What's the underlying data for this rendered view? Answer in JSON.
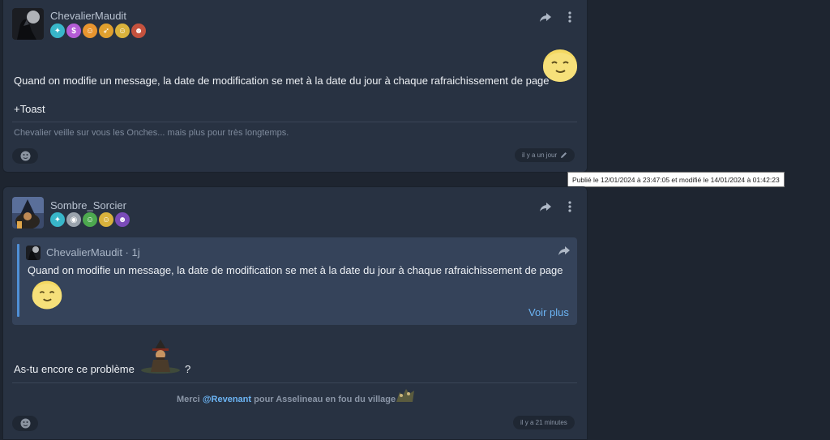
{
  "post1": {
    "username": "ChevalierMaudit",
    "badges": [
      {
        "name": "diamond-badge",
        "color": "#38b6c9",
        "glyph": "✦"
      },
      {
        "name": "dollar-badge",
        "color": "#b45cd6",
        "glyph": "$"
      },
      {
        "name": "orange-smiley-badge",
        "color": "#e8952f",
        "glyph": "☺"
      },
      {
        "name": "rocket-badge",
        "color": "#e0a02e",
        "glyph": "➶"
      },
      {
        "name": "yellow-smiley-badge",
        "color": "#d9b23c",
        "glyph": "☺"
      },
      {
        "name": "red-face-badge",
        "color": "#c5523e",
        "glyph": "☻"
      }
    ],
    "message": "Quand on modifie un message, la date de modification se met à la date du jour à chaque rafraichissement de page",
    "message_extra": "+Toast",
    "signature": "Chevalier veille sur vous les Onches... mais plus pour très longtemps.",
    "timestamp": "il y a un jour",
    "tooltip": "Publié le 12/01/2024 à 23:47:05 et modifié le 14/01/2024 à 01:42:23"
  },
  "post2": {
    "username": "Sombre_Sorcier",
    "badges": [
      {
        "name": "diamond-badge",
        "color": "#38b6c9",
        "glyph": "✦"
      },
      {
        "name": "helmet-badge",
        "color": "#9aa3ad",
        "glyph": "◉"
      },
      {
        "name": "green-hat-badge",
        "color": "#4da94f",
        "glyph": "☺"
      },
      {
        "name": "yellow-smiley-badge",
        "color": "#d9b23c",
        "glyph": "☺"
      },
      {
        "name": "purple-face-badge",
        "color": "#7a4bb8",
        "glyph": "☻"
      }
    ],
    "quote": {
      "author": "ChevalierMaudit · 1j",
      "text": "Quand on modifie un message, la date de modification se met à la date du jour à chaque rafraichissement de page",
      "more": "Voir plus"
    },
    "message": "As-tu encore ce problème",
    "message_suffix": "?",
    "footer": {
      "prefix": "Merci",
      "mention": "@Revenant",
      "suffix": "pour Asselineau en fou du village"
    },
    "timestamp": "il y a 21 minutes"
  },
  "colors": {
    "background": "#1e2530",
    "card": "#283242",
    "quote": "#35435a",
    "accent": "#6cb5f5"
  }
}
